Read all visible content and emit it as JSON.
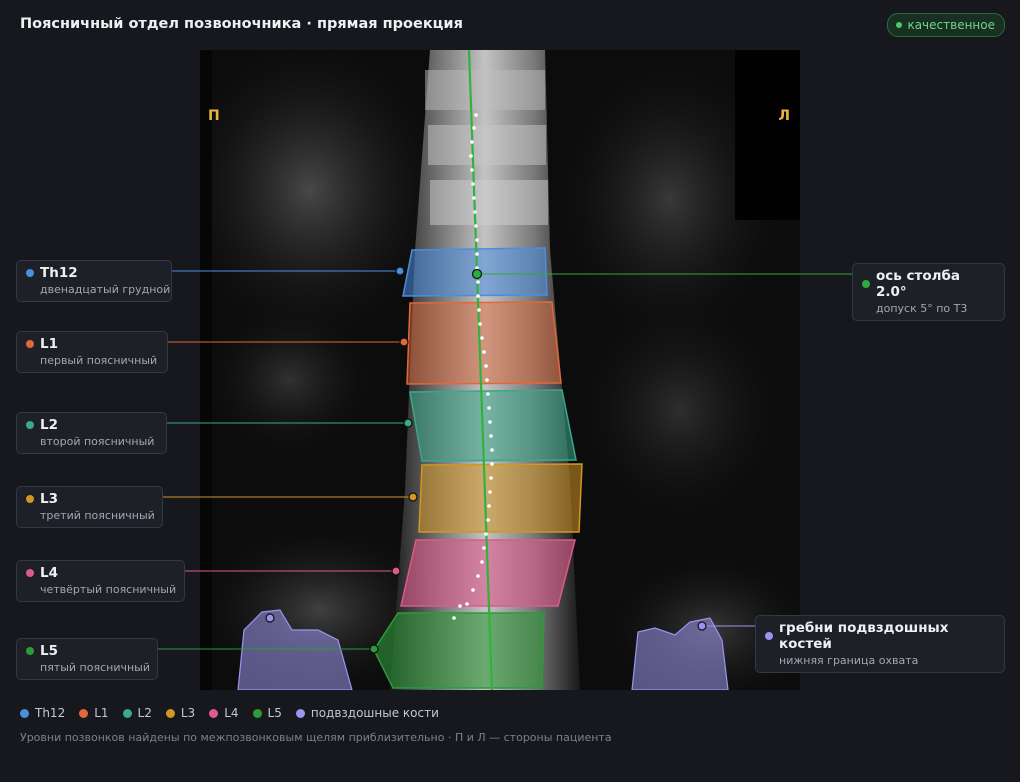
{
  "header": {
    "title": "Поясничный отдел позвоночника · прямая проекция",
    "status_badge": "качественное"
  },
  "image": {
    "right_side_label": "П",
    "left_side_label": "Л"
  },
  "vertebrae": [
    {
      "id": "th12",
      "name": "Th12",
      "description": "двенадцатый грудной",
      "color": "#4a8ee0"
    },
    {
      "id": "l1",
      "name": "L1",
      "description": "первый поясничный",
      "color": "#e0683a"
    },
    {
      "id": "l2",
      "name": "L2",
      "description": "второй поясничный",
      "color": "#3aa88a"
    },
    {
      "id": "l3",
      "name": "L3",
      "description": "третий поясничный",
      "color": "#d39524"
    },
    {
      "id": "l4",
      "name": "L4",
      "description": "четвёртый поясничный",
      "color": "#dd5a8a"
    },
    {
      "id": "l5",
      "name": "L5",
      "description": "пятый поясничный",
      "color": "#2e9a3a"
    }
  ],
  "axis_card": {
    "name": "ось столба 2.0°",
    "description": "допуск 5° по Т3",
    "color": "#2faa3c"
  },
  "iliac_card": {
    "name": "гребни подвздошных костей",
    "description": "нижняя граница охвата",
    "color": "#9a95ec"
  },
  "legend": [
    {
      "label": "Th12",
      "color": "#4a8ee0"
    },
    {
      "label": "L1",
      "color": "#e0683a"
    },
    {
      "label": "L2",
      "color": "#3aa88a"
    },
    {
      "label": "L3",
      "color": "#d39524"
    },
    {
      "label": "L4",
      "color": "#dd5a8a"
    },
    {
      "label": "L5",
      "color": "#2e9a3a"
    },
    {
      "label": "подвздошные кости",
      "color": "#9a95ec"
    }
  ],
  "footnote": "Уровни позвонков найдены по межпозвонковым щелям приблизительно · П и Л — стороны пациента"
}
